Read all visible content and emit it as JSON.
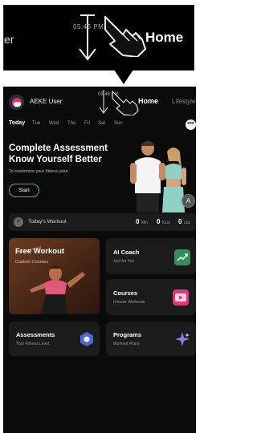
{
  "tutorial_zoom": {
    "left_text": "er",
    "time": "05:46 PM",
    "tab_label": "Home"
  },
  "header": {
    "user_name": "AEKE User",
    "time": "05:46 PM",
    "tab_home": "Home",
    "tab_lifestyle": "Lifestyle"
  },
  "days": [
    "Today",
    "Tue",
    "Wed",
    "Thu",
    "Fri",
    "Sat",
    "Sun"
  ],
  "more_button": "•••",
  "hero": {
    "title_line1": "Complete Assessment",
    "title_line2": "Know Yourself Better",
    "subtitle": "To customize your fitness plan",
    "start_label": "Start",
    "fab_label": "A"
  },
  "todays_workout": {
    "label": "Today's Workout",
    "minutes": "0",
    "minutes_unit": "Min",
    "kcal": "0",
    "kcal_unit": "Kcal",
    "lbs": "0",
    "lbs_unit": "Lbs"
  },
  "cards": {
    "free_workout": {
      "title": "Free Workout",
      "subtitle": "Custom Courses"
    },
    "ai_coach": {
      "title": "AI Coach",
      "subtitle": "Just for You"
    },
    "courses": {
      "title": "Courses",
      "subtitle": "Diverse Workouts"
    },
    "assessments": {
      "title": "Assessments",
      "subtitle": "Your Fitness Level"
    },
    "programs": {
      "title": "Programs",
      "subtitle": "Workout Plans"
    }
  },
  "colors": {
    "accent_teal": "#3fb39a",
    "background": "#0b0b0b",
    "card": "#1b1b1b"
  }
}
